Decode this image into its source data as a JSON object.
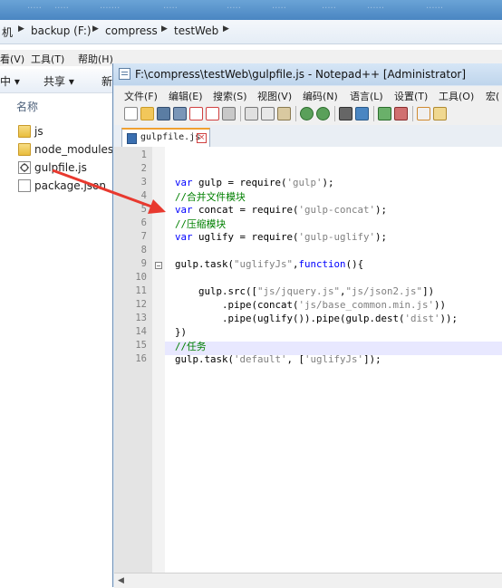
{
  "explorer": {
    "breadcrumb": [
      "机",
      "backup (F:)",
      "compress",
      "testWeb"
    ],
    "menu": [
      "看(V)",
      "工具(T)",
      "帮助(H)"
    ],
    "toolbar": {
      "organize": "中 ▾",
      "share": "共享 ▾",
      "new": "新"
    },
    "column_header": "名称",
    "files": [
      {
        "name": "js",
        "icon": "folder-icon"
      },
      {
        "name": "node_modules",
        "icon": "folder-icon"
      },
      {
        "name": "gulpfile.js",
        "icon": "js-file-icon"
      },
      {
        "name": "package.json",
        "icon": "json-file-icon"
      }
    ],
    "blurred_top_tabs": [
      "·····",
      "·····",
      "·······",
      "·····",
      "·····",
      "·····",
      "·····",
      "······",
      "······"
    ]
  },
  "notepad": {
    "title": "F:\\compress\\testWeb\\gulpfile.js - Notepad++ [Administrator]",
    "menu": [
      "文件(F)",
      "编辑(E)",
      "搜索(S)",
      "视图(V)",
      "编码(N)",
      "语言(L)",
      "设置(T)",
      "工具(O)",
      "宏("
    ],
    "tab_label": "gulpfile.js",
    "lines": [
      "1",
      "2",
      "3",
      "4",
      "5",
      "6",
      "7",
      "8",
      "9",
      "10",
      "11",
      "12",
      "13",
      "14",
      "15",
      "16"
    ],
    "code": {
      "l3a": "var",
      "l3b": " gulp = require(",
      "l3c": "'gulp'",
      "l3d": ");",
      "l4": "//合并文件模块",
      "l5a": "var",
      "l5b": " concat = require(",
      "l5c": "'gulp-concat'",
      "l5d": ");",
      "l6": "//压缩模块",
      "l7a": "var",
      "l7b": " uglify = require(",
      "l7c": "'gulp-uglify'",
      "l7d": ");",
      "l9a": "gulp.task(",
      "l9b": "\"uglifyJs\"",
      "l9c": ",",
      "l9d": "function",
      "l9e": "(){",
      "l11a": "    gulp.src([",
      "l11b": "\"js/jquery.js\"",
      "l11c": ",",
      "l11d": "\"js/json2.js\"",
      "l11e": "])",
      "l12a": "        .pipe(concat(",
      "l12b": "'js/base_common.min.js'",
      "l12c": "))",
      "l13a": "        .pipe(uglify()).pipe(gulp.dest(",
      "l13b": "'dist'",
      "l13c": "));",
      "l14": "})",
      "l15": "//任务",
      "l16a": "gulp.task(",
      "l16b": "'default'",
      "l16c": ", [",
      "l16d": "'uglifyJs'",
      "l16e": "]);"
    }
  },
  "colors": {
    "arrow": "#e8392f",
    "keyword": "#0000ff",
    "string": "#808080",
    "comment": "#008000"
  }
}
